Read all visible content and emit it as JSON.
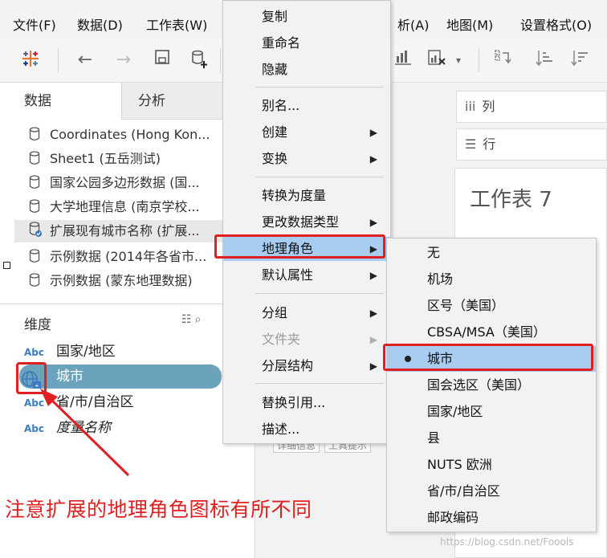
{
  "menubar": {
    "items": [
      "文件(F)",
      "数据(D)",
      "工作表(W)",
      "析(A)",
      "地图(M)",
      "设置格式(O)"
    ]
  },
  "toolbar": {
    "icons": [
      "tableau-logo-icon",
      "back-icon",
      "forward-icon",
      "save-icon",
      "new-datasource-icon",
      "chart-icon",
      "clear-sheet-icon",
      "swap-icon",
      "sort-asc-icon",
      "sort-desc-icon"
    ]
  },
  "left_pane": {
    "tabs": [
      "数据",
      "分析"
    ],
    "datasources": [
      {
        "label": "Coordinates (Hong Kon..."
      },
      {
        "label": "Sheet1 (五岳测试)"
      },
      {
        "label": "国家公园多边形数据 (国..."
      },
      {
        "label": "大学地理信息 (南京学校..."
      },
      {
        "label": "扩展现有城市名称 (扩展..."
      },
      {
        "label": "示例数据 (2014年各省市..."
      },
      {
        "label": "示例数据 (蒙东地理数据)"
      }
    ],
    "dimensions_title": "维度",
    "fields": [
      {
        "type": "Abc",
        "label": "国家/地区"
      },
      {
        "type": "geo",
        "label": "城市"
      },
      {
        "type": "Abc",
        "label": "省/市/自治区"
      },
      {
        "type": "Abc",
        "label": "度量名称"
      }
    ]
  },
  "shelves": {
    "columns_label": "列",
    "rows_label": "行",
    "sheet_title": "工作表 7",
    "mark_chips": [
      "详细信息",
      "工具提示"
    ]
  },
  "context_menu": {
    "items": [
      {
        "label": "复制",
        "arrow": false
      },
      {
        "label": "重命名",
        "arrow": false
      },
      {
        "label": "隐藏",
        "arrow": false
      },
      {
        "label": "别名...",
        "arrow": false
      },
      {
        "label": "创建",
        "arrow": true
      },
      {
        "label": "变换",
        "arrow": true
      },
      {
        "label": "转换为度量",
        "arrow": false
      },
      {
        "label": "更改数据类型",
        "arrow": true
      },
      {
        "label": "地理角色",
        "arrow": true
      },
      {
        "label": "默认属性",
        "arrow": true
      },
      {
        "label": "分组",
        "arrow": true
      },
      {
        "label": "文件夹",
        "arrow": true
      },
      {
        "label": "分层结构",
        "arrow": true
      },
      {
        "label": "替换引用...",
        "arrow": false
      },
      {
        "label": "描述...",
        "arrow": false
      }
    ],
    "arrow_glyph": "▶"
  },
  "submenu": {
    "items": [
      "无",
      "机场",
      "区号（美国）",
      "CBSA/MSA（美国）",
      "城市",
      "国会选区（美国）",
      "国家/地区",
      "县",
      "NUTS 欧洲",
      "省/市/自治区",
      "邮政编码"
    ],
    "selected": "城市"
  },
  "annotation": "注意扩展的地理角色图标有所不同",
  "watermark": "https://blog.csdn.net/Foools",
  "colors": {
    "highlight": "#a8cdf0",
    "annotation_red": "#e02020",
    "pill_blue": "#6aa3bb",
    "abc_blue": "#3b7bbf"
  }
}
